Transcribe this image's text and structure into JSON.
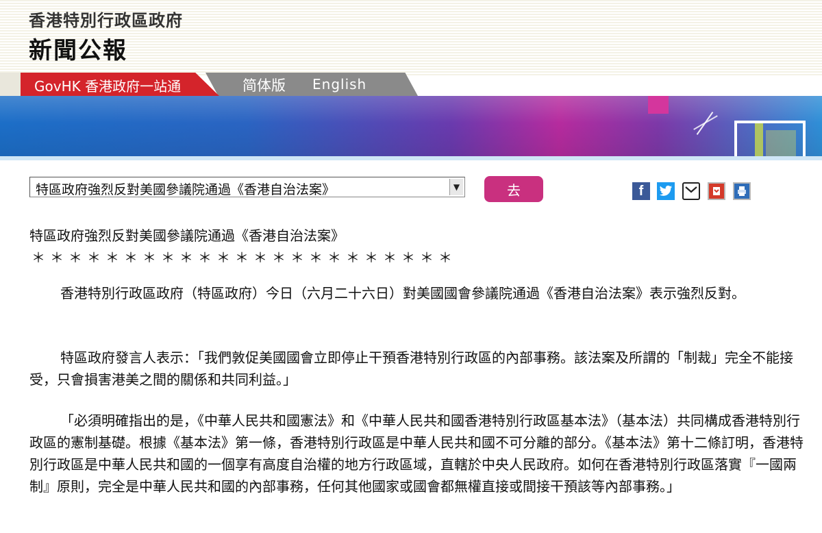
{
  "header": {
    "gov_name": "香港特別行政區政府",
    "press_title": "新聞公報"
  },
  "nav": {
    "govhk_label": "GovHK 香港政府一站通",
    "simplified_label": "简体版",
    "english_label": "English"
  },
  "colors": {
    "govhk_tab": "#d4242b",
    "lang_tab": "#8a8a8a",
    "go_button": "#c9307f"
  },
  "controls": {
    "selected_article": "特區政府強烈反對美國參議院通過《香港自治法案》",
    "go_label": "去"
  },
  "share_icons": [
    "facebook-icon",
    "twitter-icon",
    "email-icon",
    "bookmark-icon",
    "print-icon"
  ],
  "article": {
    "title": "特區政府強烈反對美國參議院通過《香港自治法案》",
    "separator": "＊＊＊＊＊＊＊＊＊＊＊＊＊＊＊＊＊＊＊＊＊＊＊",
    "paragraphs": [
      "香港特別行政區政府（特區政府）今日（六月二十六日）對美國國會參議院通過《香港自治法案》表示強烈反對。",
      "特區政府發言人表示：「我們敦促美國國會立即停止干預香港特別行政區的內部事務。該法案及所謂的「制裁」完全不能接受，只會損害港美之間的關係和共同利益。」",
      "「必須明確指出的是，《中華人民共和國憲法》和《中華人民共和國香港特別行政區基本法》（基本法）共同構成香港特別行政區的憲制基礎。根據《基本法》第一條，香港特別行政區是中華人民共和國不可分離的部分。《基本法》第十二條訂明，香港特別行政區是中華人民共和國的一個享有高度自治權的地方行政區域，直轄於中央人民政府。如何在香港特別行政區落實『一國兩制』原則，完全是中華人民共和國的內部事務，任何其他國家或國會都無權直接或間接干預該等內部事務。」"
    ]
  }
}
